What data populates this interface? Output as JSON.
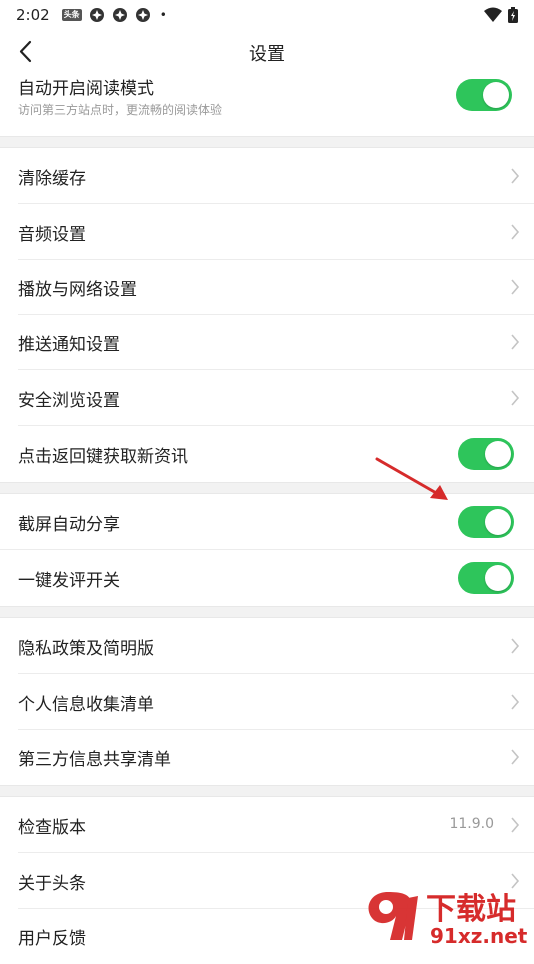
{
  "status_bar": {
    "time": "2:02",
    "news_chip": "头条",
    "dot": "•"
  },
  "nav": {
    "title": "设置"
  },
  "auto_read": {
    "title": "自动开启阅读模式",
    "subtitle": "访问第三方站点时，更流畅的阅读体验",
    "enabled": true
  },
  "group1": [
    {
      "label": "清除缓存"
    },
    {
      "label": "音频设置"
    },
    {
      "label": "播放与网络设置"
    },
    {
      "label": "推送通知设置"
    },
    {
      "label": "安全浏览设置"
    },
    {
      "label": "点击返回键获取新资讯",
      "enabled": true
    }
  ],
  "group2": [
    {
      "label": "截屏自动分享",
      "enabled": true
    },
    {
      "label": "一键发评开关",
      "enabled": true
    }
  ],
  "group3": [
    {
      "label": "隐私政策及简明版"
    },
    {
      "label": "个人信息收集清单"
    },
    {
      "label": "第三方信息共享清单"
    }
  ],
  "group4": [
    {
      "label": "检查版本",
      "value": "11.9.0"
    },
    {
      "label": "关于头条"
    },
    {
      "label": "用户反馈"
    }
  ],
  "watermark": {
    "brand": "下载站",
    "domain": "91xz.net"
  },
  "colors": {
    "toggle_on": "#2ec55b",
    "arrow": "#d62b2b"
  }
}
